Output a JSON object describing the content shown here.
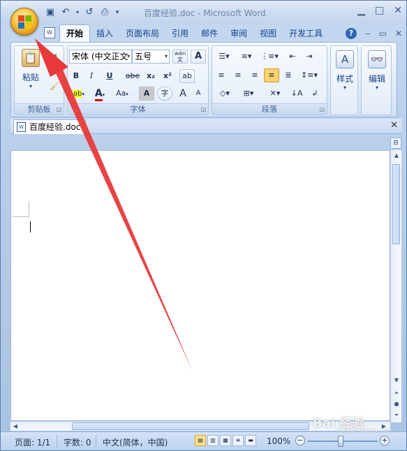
{
  "window": {
    "title": "百度经验.doc - Microsoft Word"
  },
  "tabs": [
    "开始",
    "插入",
    "页面布局",
    "引用",
    "邮件",
    "审阅",
    "视图",
    "开发工具"
  ],
  "ribbon": {
    "clipboard": {
      "label": "剪贴板",
      "paste": "粘贴"
    },
    "font": {
      "label": "字体",
      "font_name": "宋体 (中文正文",
      "font_size": "五号",
      "wen_button": "wén 文",
      "bold": "B",
      "italic": "I",
      "underline": "U",
      "strike": "abe",
      "subscript": "x₂",
      "superscript": "x²",
      "aa_case": "Aa",
      "char_shading": "A",
      "enclose": "字",
      "grow": "A",
      "shrink": "A"
    },
    "paragraph": {
      "label": "段落"
    },
    "styles": {
      "label": "样式"
    },
    "editing": {
      "label": "编辑"
    }
  },
  "document": {
    "tab_label": "百度经验.doc"
  },
  "status": {
    "page": "页面: 1/1",
    "words": "字数: 0",
    "language": "中文(简体，中国)",
    "zoom": "100%"
  },
  "watermark": {
    "brand": "Bai 经验",
    "url": "jingyan.baidu.com"
  },
  "colors": {
    "highlight": "#ffff00",
    "font_color": "#e00000",
    "annotation_arrow": "#e8393a"
  }
}
